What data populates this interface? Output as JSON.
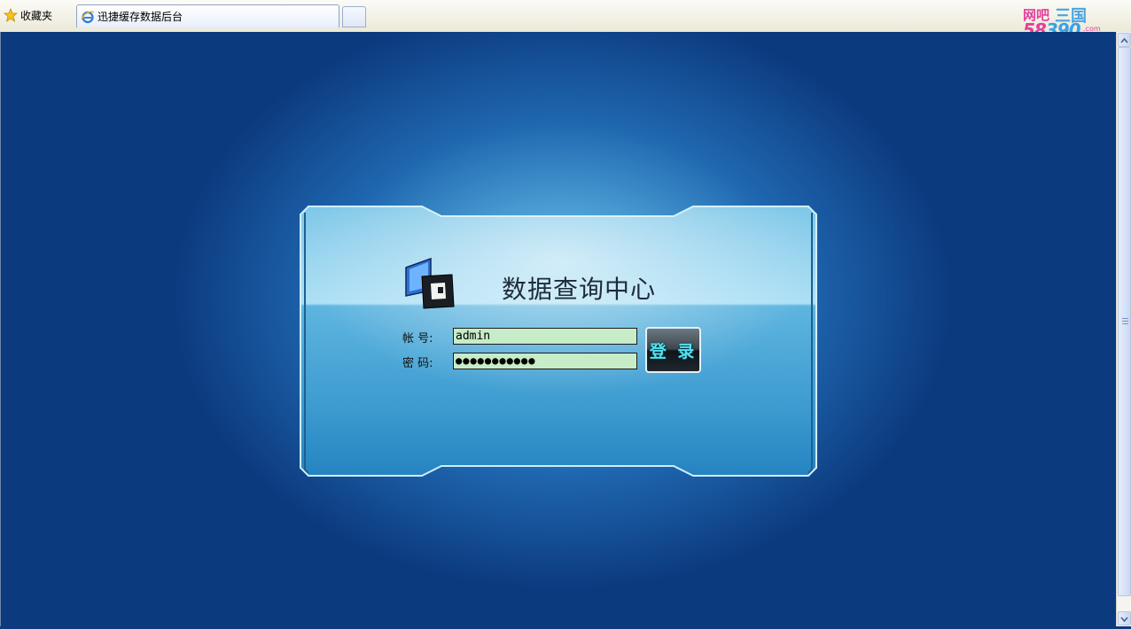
{
  "browser": {
    "favorites_label": "收藏夹",
    "active_tab_title": "迅捷缓存数据后台",
    "brand_top": "网吧",
    "brand_sanguo": "三国",
    "brand_num_a": "58",
    "brand_num_b": "390",
    "brand_com": ".com"
  },
  "login": {
    "title": "数据查询中心",
    "username_label": "帐  号:",
    "password_label": "密  码:",
    "username_value": "admin",
    "password_masked": "●●●●●●●●●●●",
    "login_button": "登 录"
  },
  "colors": {
    "page_background": "#0c3a7e",
    "field_background": "#c7ecc8",
    "button_text": "#56e0f0",
    "panel_border": "#cfeefa"
  },
  "icons": {
    "favorites": "star-icon",
    "tab": "ie-icon",
    "panel_logo": "data-center-logo"
  }
}
